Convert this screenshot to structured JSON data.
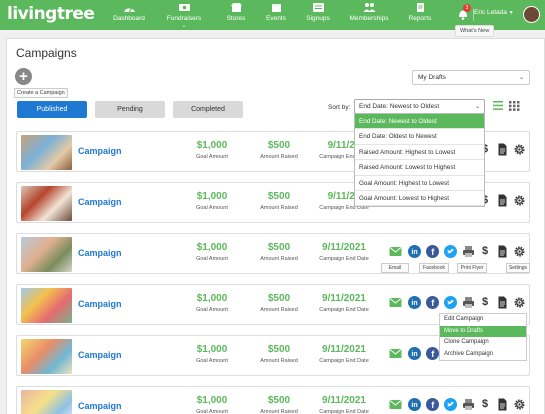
{
  "app": {
    "logo": "livingtree",
    "brand_color": "#5cb85c",
    "accent_color": "#1f78d1"
  },
  "nav": {
    "items": [
      {
        "label": "Dashboard",
        "icon": "dashboard-icon"
      },
      {
        "label": "Fundraisers",
        "icon": "money-icon",
        "has_dropdown": true
      },
      {
        "label": "Stores",
        "icon": "store-icon"
      },
      {
        "label": "Events",
        "icon": "calendar-icon"
      },
      {
        "label": "Signups",
        "icon": "clipboard-icon"
      },
      {
        "label": "Memberships",
        "icon": "people-icon"
      },
      {
        "label": "Reports",
        "icon": "report-icon"
      }
    ],
    "notifications": {
      "count": "3",
      "tooltip": "What's New"
    },
    "user": {
      "name": "Eric Letada",
      "caret": "▼"
    }
  },
  "page": {
    "title": "Campaigns",
    "create_tooltip": "Create a Campaign",
    "drafts_select": {
      "value": "My Drafts"
    },
    "tabs": [
      {
        "label": "Published",
        "active": true
      },
      {
        "label": "Pending",
        "active": false
      },
      {
        "label": "Completed",
        "active": false
      }
    ],
    "sort": {
      "label": "Sort by:",
      "value": "End Date: Newest to Oldest",
      "options": [
        {
          "label": "End Date: Newest to Oldest",
          "selected": true
        },
        {
          "label": "End Date: Oldest to Newest"
        },
        {
          "label": "Raised Amount: Highest to Lowest"
        },
        {
          "label": "Raised Amount: Lowest to Highest"
        },
        {
          "label": "Goal Amount: Highest to Lowest"
        },
        {
          "label": "Goal Amount: Lowest to Highest"
        }
      ]
    }
  },
  "campaigns": [
    {
      "title": "Campaign",
      "goal": "$1,000",
      "goal_caption": "Goal Amount",
      "raised": "$500",
      "raised_caption": "Amount Raised",
      "end": "9/11/20",
      "end_caption": "Campaign End Date"
    },
    {
      "title": "Campaign",
      "goal": "$1,000",
      "goal_caption": "Goal Amount",
      "raised": "$500",
      "raised_caption": "Amount Raised",
      "end": "9/11/20",
      "end_caption": "Campaign End Date"
    },
    {
      "title": "Campaign",
      "goal": "$1,000",
      "goal_caption": "Goal Amount",
      "raised": "$500",
      "raised_caption": "Amount Raised",
      "end": "9/11/2021",
      "end_caption": "Campaign End Date"
    },
    {
      "title": "Campaign",
      "goal": "$1,000",
      "goal_caption": "Goal Amount",
      "raised": "$500",
      "raised_caption": "Amount Raised",
      "end": "9/11/2021",
      "end_caption": "Campaign End Date"
    },
    {
      "title": "Campaign",
      "goal": "$1,000",
      "goal_caption": "Goal Amount",
      "raised": "$500",
      "raised_caption": "Amount Raised",
      "end": "9/11/2021",
      "end_caption": "Campaign End Date"
    },
    {
      "title": "Campaign",
      "goal": "$1,000",
      "goal_caption": "Goal Amount",
      "raised": "$500",
      "raised_caption": "Amount Raised",
      "end": "9/11/2021",
      "end_caption": "Campaign End Date"
    }
  ],
  "action_tooltips": {
    "email": "Email",
    "facebook": "Facebook",
    "print": "Print Flyer",
    "settings": "Settings"
  },
  "dollar_glyph": "$",
  "context_menu": {
    "items": [
      {
        "label": "Edit Campaign"
      },
      {
        "label": "Move to Drafts",
        "highlighted": true
      },
      {
        "label": "Clone Campaign"
      },
      {
        "label": "Archive Campaign"
      }
    ]
  }
}
